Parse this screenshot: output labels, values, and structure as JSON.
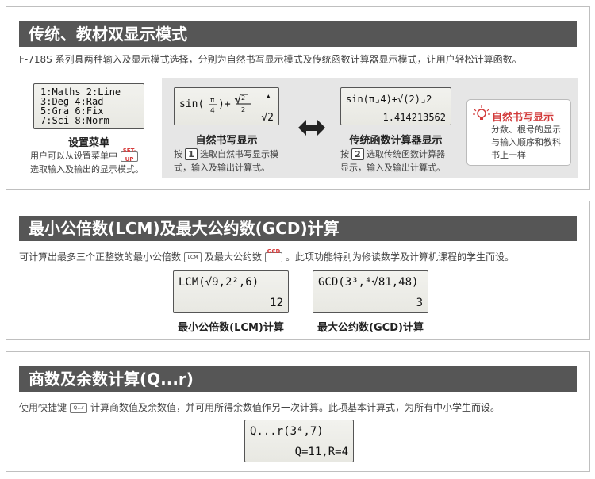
{
  "section1": {
    "title": "传统、教材双显示模式",
    "desc": "F-718S 系列具两种输入及显示模式选择，分别为自然书写显示模式及传统函数计算器显示模式，让用户轻松计算函数。",
    "setup_lcd_lines": [
      "1:Maths 2:Line",
      "3:Deg   4:Rad",
      "5:Gra   6:Fix",
      "7:Sci   8:Norm"
    ],
    "setup_caption": "设置菜单",
    "setup_desc_a": "用户可以从设置菜单中",
    "setup_key_label": "SET-UP",
    "setup_desc_b": "选取输入及输出的显示模式。",
    "natural_lcd_result": "√2",
    "natural_caption": "自然书写显示",
    "natural_desc_a": "按",
    "natural_key": "1",
    "natural_desc_b": "选取自然书写显示模",
    "natural_desc_c": "式，输入及输出计算式。",
    "traditional_lcd_expr": "sin(π⌟4)+√(2)⌟2",
    "traditional_lcd_result": "1.414213562",
    "traditional_caption": "传统函数计算器显示",
    "traditional_desc_a": "按",
    "traditional_key": "2",
    "traditional_desc_b": "选取传统函数计算器",
    "traditional_desc_c": "显示，输入及输出计算式。",
    "tip_title": "自然书写显示",
    "tip_lines": [
      "分数、根号的显示",
      "与输入顺序和教科",
      "书上一样"
    ]
  },
  "section2": {
    "title": "最小公倍数(LCM)及最大公约数(GCD)计算",
    "desc_a": "可计算出最多三个正整数的最小公倍数",
    "lcm_key": "LCM",
    "desc_b": "及最大公约数",
    "gcd_key_label": "GCD",
    "desc_c": "。此项功能特别为修读数学及计算机课程的学生而设。",
    "lcm_lcd_expr": "LCM(√9,2²,6)",
    "lcm_lcd_result": "12",
    "lcm_caption": "最小公倍数(LCM)计算",
    "gcd_lcd_expr": "GCD(3³,⁴√81,48)",
    "gcd_lcd_result": "3",
    "gcd_caption": "最大公约数(GCD)计算"
  },
  "section3": {
    "title": "商数及余数计算(Q...r)",
    "desc_a": "使用快捷键",
    "qr_key": "Q...r",
    "desc_b": "计算商数值及余数值，并可用所得余数值作另一次计算。此项基本计算式，为所有中小学生而设。",
    "qr_lcd_expr": "Q...r(3⁴,7)",
    "qr_lcd_result": "Q=11,R=4"
  },
  "colors": {
    "header_bg": "#565656",
    "accent": "#d23b3b",
    "grey_area": "#e6e6e6"
  },
  "icons": {
    "arrow": "double-arrow-icon",
    "bulb": "lightbulb-icon"
  }
}
